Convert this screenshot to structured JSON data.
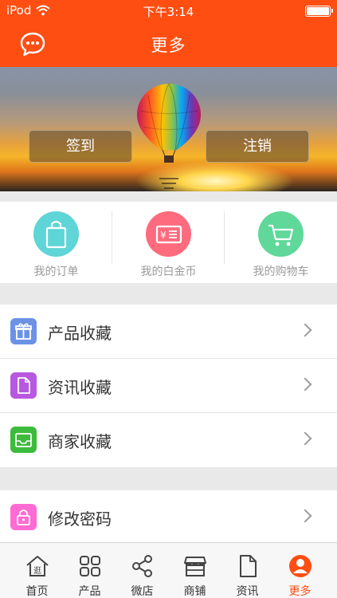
{
  "status": {
    "carrier": "iPod",
    "time": "下午3:14"
  },
  "navbar": {
    "title": "更多"
  },
  "banner": {
    "signin": "签到",
    "logout": "注销"
  },
  "shortcuts": [
    {
      "label": "我的订单",
      "color": "#5fd5d7",
      "icon": "bag-icon"
    },
    {
      "label": "我的白金币",
      "color": "#fe6b7e",
      "icon": "coin-card-icon"
    },
    {
      "label": "我的购物车",
      "color": "#5fd89a",
      "icon": "cart-icon"
    }
  ],
  "favorites": [
    {
      "label": "产品收藏",
      "color": "#6c92e6",
      "icon": "gift-icon"
    },
    {
      "label": "资讯收藏",
      "color": "#b858e0",
      "icon": "document-icon"
    },
    {
      "label": "商家收藏",
      "color": "#3dbb3d",
      "icon": "inbox-icon"
    }
  ],
  "settings": [
    {
      "label": "修改密码",
      "color": "#ff6bd3",
      "icon": "lock-icon"
    }
  ],
  "tabs": [
    {
      "label": "首页",
      "icon": "home-icon"
    },
    {
      "label": "产品",
      "icon": "grid-icon"
    },
    {
      "label": "微店",
      "icon": "share-icon"
    },
    {
      "label": "商铺",
      "icon": "shop-icon"
    },
    {
      "label": "资讯",
      "icon": "document-icon"
    },
    {
      "label": "更多",
      "icon": "user-icon",
      "active": true
    }
  ],
  "colors": {
    "brand": "#ff4e12"
  }
}
